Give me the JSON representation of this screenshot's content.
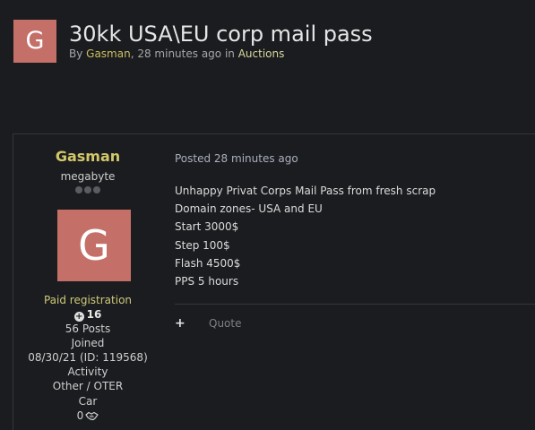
{
  "topic": {
    "avatar_letter": "G",
    "title": "30kk USA\\EU corp mail pass",
    "meta_by": "By ",
    "author": "Gasman",
    "meta_mid": ", 28 minutes ago in ",
    "forum": "Auctions"
  },
  "author_panel": {
    "name": "Gasman",
    "rank": "megabyte",
    "avatar_letter": "G",
    "group": "Paid registration",
    "reputation": "16",
    "posts": "56 Posts",
    "joined_label": "Joined",
    "joined_value": "08/30/21 (ID: 119568)",
    "activity_label": "Activity",
    "activity_value": "Other / OTER",
    "car_label": "Car",
    "car_value": "0"
  },
  "post": {
    "posted": "Posted 28 minutes ago",
    "lines": [
      "Unhappy Privat Corps Mail Pass from fresh scrap",
      "Domain zones- USA and EU",
      "Start 3000$",
      "Step 100$",
      "Flash 4500$",
      "PPS 5 hours"
    ],
    "quote_label": "Quote"
  },
  "colors": {
    "avatar_bg": "#c47068",
    "author_name": "#d2c86a",
    "background": "#1b1c1f",
    "border": "#34363a"
  }
}
